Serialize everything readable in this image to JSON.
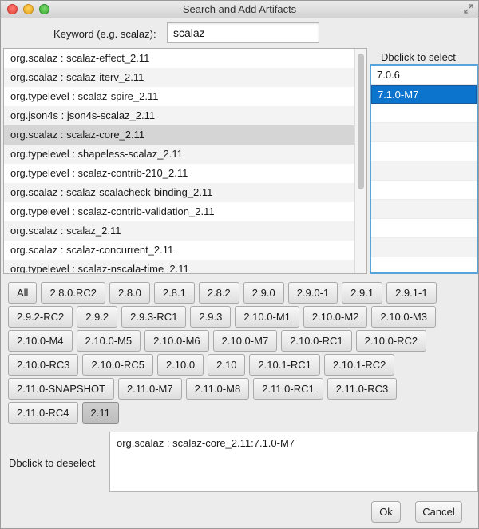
{
  "window": {
    "title": "Search and Add Artifacts"
  },
  "search": {
    "label": "Keyword (e.g. scalaz):",
    "value": "scalaz"
  },
  "artifacts": [
    "org.scalaz : scalaz-effect_2.11",
    "org.scalaz : scalaz-iterv_2.11",
    "org.typelevel : scalaz-spire_2.11",
    "org.json4s : json4s-scalaz_2.11",
    "org.scalaz : scalaz-core_2.11",
    "org.typelevel : shapeless-scalaz_2.11",
    "org.typelevel : scalaz-contrib-210_2.11",
    "org.scalaz : scalaz-scalacheck-binding_2.11",
    "org.typelevel : scalaz-contrib-validation_2.11",
    "org.scalaz : scalaz_2.11",
    "org.scalaz : scalaz-concurrent_2.11",
    "org.typelevel : scalaz-nscala-time_2.11"
  ],
  "selected_artifact_index": 4,
  "versions": {
    "title": "Dbclick to select",
    "items": [
      "7.0.6",
      "7.1.0-M7"
    ],
    "selected_index": 1
  },
  "scala_versions": {
    "rows": [
      [
        "All",
        "2.8.0.RC2",
        "2.8.0",
        "2.8.1",
        "2.8.2",
        "2.9.0",
        "2.9.0-1",
        "2.9.1",
        "2.9.1-1"
      ],
      [
        "2.9.2-RC2",
        "2.9.2",
        "2.9.3-RC1",
        "2.9.3",
        "2.10.0-M1",
        "2.10.0-M2",
        "2.10.0-M3"
      ],
      [
        "2.10.0-M4",
        "2.10.0-M5",
        "2.10.0-M6",
        "2.10.0-M7",
        "2.10.0-RC1",
        "2.10.0-RC2"
      ],
      [
        "2.10.0-RC3",
        "2.10.0-RC5",
        "2.10.0",
        "2.10",
        "2.10.1-RC1",
        "2.10.1-RC2"
      ],
      [
        "2.11.0-SNAPSHOT",
        "2.11.0-M7",
        "2.11.0-M8",
        "2.11.0-RC1",
        "2.11.0-RC3"
      ],
      [
        "2.11.0-RC4",
        "2.11"
      ]
    ],
    "selected": "2.11"
  },
  "selected_artifacts": {
    "label": "Dbclick to deselect",
    "items": [
      "org.scalaz : scalaz-core_2.11:7.1.0-M7"
    ]
  },
  "buttons": {
    "ok": "Ok",
    "cancel": "Cancel"
  },
  "colors": {
    "selection_blue": "#0d74cd",
    "focus_border": "#57a4dc"
  }
}
